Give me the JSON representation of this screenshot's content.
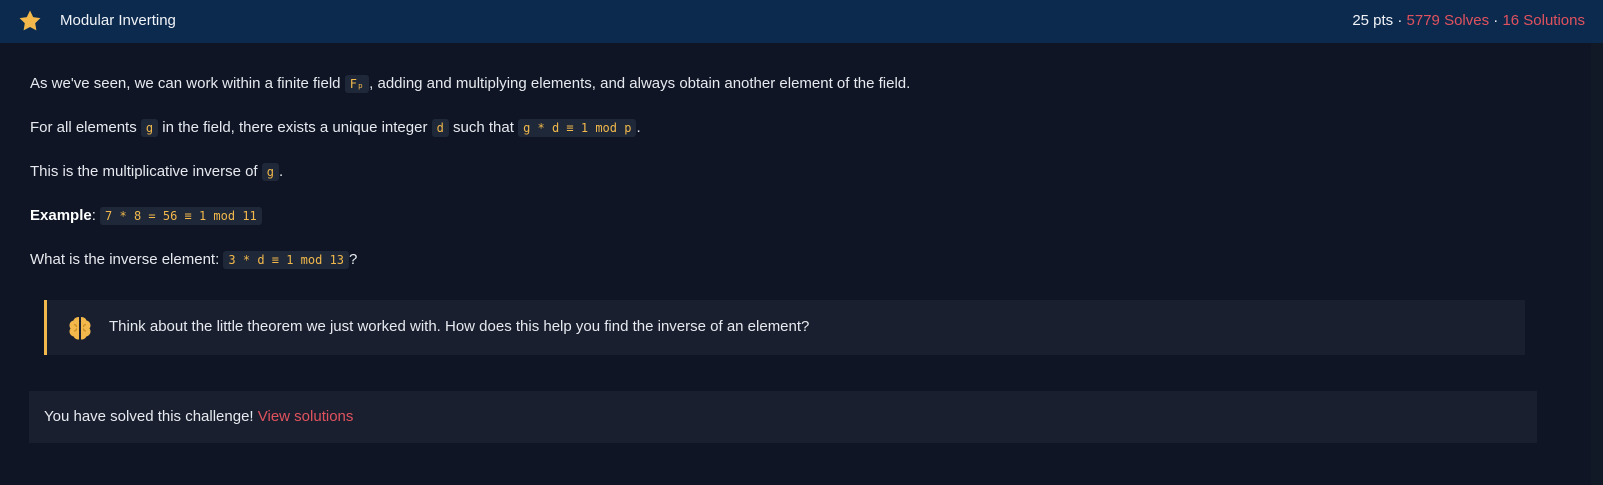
{
  "header": {
    "icon": "star-icon",
    "title": "Modular Inverting",
    "points": "25 pts",
    "separator": "·",
    "solves": "5779 Solves",
    "solutions": "16 Solutions"
  },
  "body": {
    "p1_before": "As we've seen, we can work within a finite field ",
    "p1_code": "Fₚ",
    "p1_after": ", adding and multiplying elements, and always obtain another element of the field.",
    "p2_before": "For all elements ",
    "p2_code1": "g",
    "p2_mid1": " in the field, there exists a unique integer ",
    "p2_code2": "d",
    "p2_mid2": " such that ",
    "p2_code3": "g * d ≡ 1 mod p",
    "p2_after": ".",
    "p3_before": "This is the multiplicative inverse of ",
    "p3_code": "g",
    "p3_after": ".",
    "p4_bold": "Example",
    "p4_colon": ": ",
    "p4_code": "7 * 8 = 56 ≡ 1 mod 11",
    "p5_before": "What is the inverse element: ",
    "p5_code": "3 * d ≡ 1 mod 13",
    "p5_after": "?"
  },
  "hint": {
    "icon": "brain-icon",
    "text": "Think about the little theorem we just worked with. How does this help you find the inverse of an element?"
  },
  "solved": {
    "text": "You have solved this challenge! ",
    "link": "View solutions"
  },
  "colors": {
    "header_bg": "#0b2a4e",
    "page_bg": "#0f1524",
    "accent_red": "#e0525e",
    "accent_yellow": "#f2b84b"
  }
}
